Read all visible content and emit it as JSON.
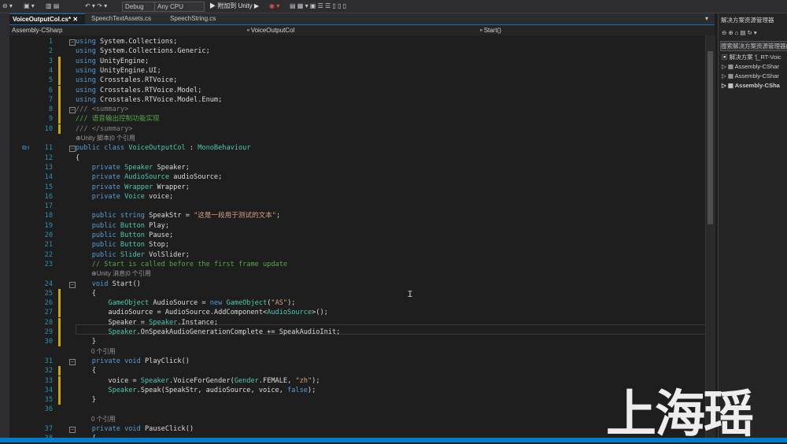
{
  "toolbar": {
    "config": "Debug",
    "platform": "Any CPU",
    "attach": "▶ 附加到 Unity ▶"
  },
  "tabs": [
    {
      "label": "VoiceOutputCol.cs*"
    },
    {
      "label": "SpeechTextAssets.cs"
    },
    {
      "label": "SpeechString.cs"
    }
  ],
  "nav": {
    "project": "Assembly-CSharp",
    "class": "VoiceOutputCol",
    "member": "Start()"
  },
  "code": [
    {
      "n": "1",
      "segs": [
        [
          "kw",
          "using "
        ],
        [
          "ns",
          "System.Collections;"
        ]
      ]
    },
    {
      "n": "2",
      "segs": [
        [
          "kw",
          "using "
        ],
        [
          "ns",
          "System.Collections.Generic;"
        ]
      ]
    },
    {
      "n": "3",
      "segs": [
        [
          "kw",
          "using "
        ],
        [
          "ns",
          "UnityEngine;"
        ]
      ]
    },
    {
      "n": "4",
      "segs": [
        [
          "kw",
          "using "
        ],
        [
          "ns",
          "UnityEngine.UI;"
        ]
      ]
    },
    {
      "n": "5",
      "segs": [
        [
          "kw",
          "using "
        ],
        [
          "ns",
          "Crosstales.RTVoice;"
        ]
      ]
    },
    {
      "n": "6",
      "segs": [
        [
          "kw",
          "using "
        ],
        [
          "ns",
          "Crosstales.RTVoice.Model;"
        ]
      ]
    },
    {
      "n": "7",
      "segs": [
        [
          "kw",
          "using "
        ],
        [
          "ns",
          "Crosstales.RTVoice.Model.Enum;"
        ]
      ]
    },
    {
      "n": "8",
      "segs": [
        [
          "uk",
          "/// "
        ],
        [
          "uk",
          "<summary>"
        ]
      ]
    },
    {
      "n": "9",
      "segs": [
        [
          "cm",
          "/// 语音输出控制功能实现"
        ]
      ]
    },
    {
      "n": "10",
      "segs": [
        [
          "uk",
          "/// "
        ],
        [
          "uk",
          "</summary>"
        ]
      ]
    },
    {
      "n": "11",
      "segs": [
        [
          "kw",
          "public class "
        ],
        [
          "ty",
          "VoiceOutputCol"
        ],
        [
          "ns",
          " : "
        ],
        [
          "ty",
          "MonoBehaviour"
        ]
      ]
    },
    {
      "n": "12",
      "segs": [
        [
          "ns",
          "{"
        ]
      ]
    },
    {
      "n": "13",
      "segs": [
        [
          "kw",
          "    private "
        ],
        [
          "ty",
          "Speaker"
        ],
        [
          "ns",
          " Speaker;"
        ]
      ]
    },
    {
      "n": "14",
      "segs": [
        [
          "kw",
          "    private "
        ],
        [
          "ty",
          "AudioSource"
        ],
        [
          "ns",
          " audioSource;"
        ]
      ]
    },
    {
      "n": "15",
      "segs": [
        [
          "kw",
          "    private "
        ],
        [
          "ty",
          "Wrapper"
        ],
        [
          "ns",
          " Wrapper;"
        ]
      ]
    },
    {
      "n": "16",
      "segs": [
        [
          "kw",
          "    private "
        ],
        [
          "ty",
          "Voice"
        ],
        [
          "ns",
          " voice;"
        ]
      ]
    },
    {
      "n": "17",
      "segs": [
        [
          "ns",
          ""
        ]
      ]
    },
    {
      "n": "18",
      "segs": [
        [
          "kw",
          "    public string "
        ],
        [
          "ns",
          "SpeakStr = "
        ],
        [
          "st",
          "\"这是一段用于测试的文本\""
        ],
        [
          "ns",
          ";"
        ]
      ]
    },
    {
      "n": "19",
      "segs": [
        [
          "kw",
          "    public "
        ],
        [
          "ty",
          "Button"
        ],
        [
          "ns",
          " Play;"
        ]
      ]
    },
    {
      "n": "20",
      "segs": [
        [
          "kw",
          "    public "
        ],
        [
          "ty",
          "Button"
        ],
        [
          "ns",
          " Pause;"
        ]
      ]
    },
    {
      "n": "21",
      "segs": [
        [
          "kw",
          "    public "
        ],
        [
          "ty",
          "Button"
        ],
        [
          "ns",
          " Stop;"
        ]
      ]
    },
    {
      "n": "22",
      "segs": [
        [
          "kw",
          "    public "
        ],
        [
          "ty",
          "Slider"
        ],
        [
          "ns",
          " VolSlider;"
        ]
      ]
    },
    {
      "n": "23",
      "segs": [
        [
          "cm",
          "    // Start is called before the first frame update"
        ]
      ]
    },
    {
      "n": "24",
      "segs": [
        [
          "kw",
          "    void "
        ],
        [
          "ns",
          "Start()"
        ]
      ]
    },
    {
      "n": "25",
      "segs": [
        [
          "ns",
          "    {"
        ]
      ]
    },
    {
      "n": "26",
      "segs": [
        [
          "ty",
          "        GameObject"
        ],
        [
          "ns",
          " AudioSource = "
        ],
        [
          "kw",
          "new "
        ],
        [
          "ty",
          "GameObject"
        ],
        [
          "ns",
          "("
        ],
        [
          "st",
          "\"AS\""
        ],
        [
          "ns",
          ");"
        ]
      ]
    },
    {
      "n": "27",
      "segs": [
        [
          "ns",
          "        audioSource = AudioSource.AddComponent<"
        ],
        [
          "ty",
          "AudioSource"
        ],
        [
          "ns",
          ">();"
        ]
      ]
    },
    {
      "n": "28",
      "segs": [
        [
          "ns",
          "        Speaker = "
        ],
        [
          "ty",
          "Speaker"
        ],
        [
          "ns",
          ".Instance;"
        ]
      ]
    },
    {
      "n": "29",
      "segs": [
        [
          "ty",
          "        Speaker"
        ],
        [
          "ns",
          ".OnSpeakAudioGenerationComplete += SpeakAudioInit;"
        ]
      ]
    },
    {
      "n": "30",
      "segs": [
        [
          "ns",
          "    }"
        ]
      ]
    },
    {
      "n": "31",
      "segs": [
        [
          "kw",
          "    private void "
        ],
        [
          "ns",
          "PlayClick()"
        ]
      ]
    },
    {
      "n": "32",
      "segs": [
        [
          "ns",
          "    {"
        ]
      ]
    },
    {
      "n": "33",
      "segs": [
        [
          "ns",
          "        voice = "
        ],
        [
          "ty",
          "Speaker"
        ],
        [
          "ns",
          ".VoiceForGender("
        ],
        [
          "ty",
          "Gender"
        ],
        [
          "ns",
          ".FEMALE, "
        ],
        [
          "st",
          "\"zh\""
        ],
        [
          "ns",
          ");"
        ]
      ]
    },
    {
      "n": "34",
      "segs": [
        [
          "ty",
          "        Speaker"
        ],
        [
          "ns",
          ".Speak(SpeakStr, audioSource, voice, "
        ],
        [
          "kw",
          "false"
        ],
        [
          "ns",
          ");"
        ]
      ]
    },
    {
      "n": "35",
      "segs": [
        [
          "ns",
          "    }"
        ]
      ]
    },
    {
      "n": "36",
      "segs": [
        [
          "ns",
          ""
        ]
      ]
    },
    {
      "n": "37",
      "segs": [
        [
          "kw",
          "    private void "
        ],
        [
          "ns",
          "PauseClick()"
        ]
      ]
    },
    {
      "n": "38",
      "segs": [
        [
          "ns",
          "    {"
        ]
      ]
    }
  ],
  "lens": [
    {
      "after": "10",
      "text": "⊕Unity 脚本|0 个引用"
    },
    {
      "after": "23",
      "text": "⊕Unity 消息|0 个引用"
    },
    {
      "after": "30",
      "text": "0 个引用"
    },
    {
      "after": "36",
      "text": "0 个引用"
    }
  ],
  "solution": {
    "title": "解决方案资源管理器",
    "search": "搜索解决方案资源管理器(C",
    "items": [
      "解决方案 '[_RT-Voic",
      "Assembly-CShar",
      "Assembly-CShar",
      "Assembly-CSha"
    ]
  },
  "watermark": "上海瑶"
}
